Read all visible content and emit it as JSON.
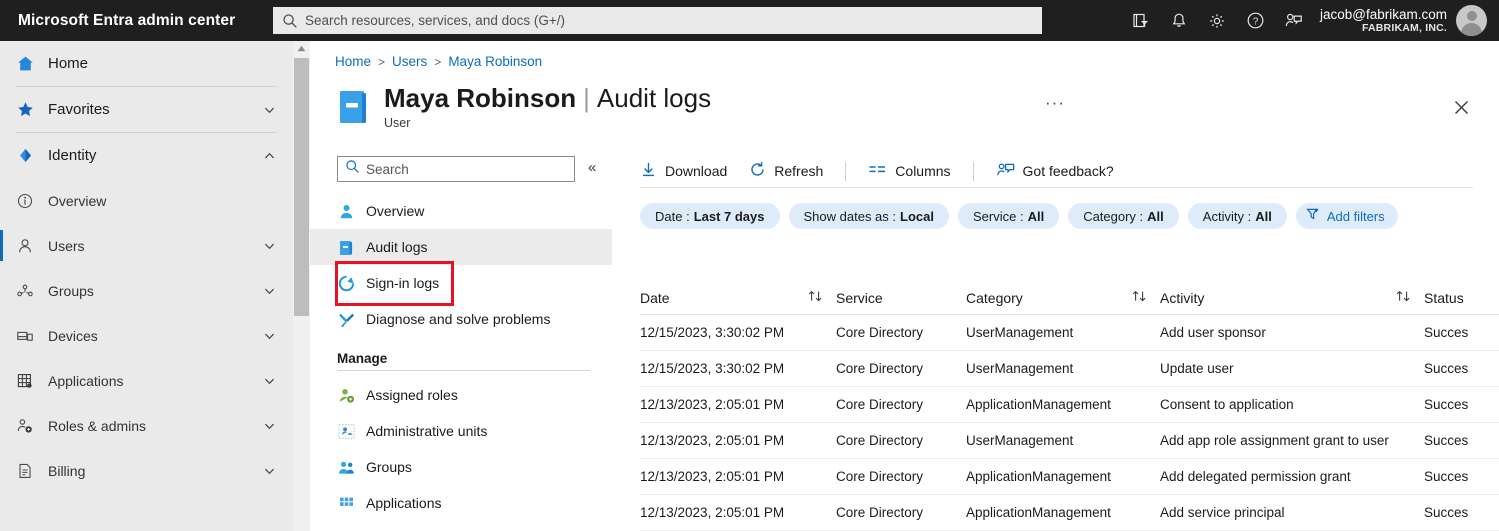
{
  "topbar": {
    "brand": "Microsoft Entra admin center",
    "search_placeholder": "Search resources, services, and docs (G+/)",
    "icons": [
      "directories-filter-icon",
      "notifications-bell-icon",
      "settings-gear-icon",
      "help-question-icon",
      "feedback-person-icon"
    ],
    "account_email": "jacob@fabrikam.com",
    "account_org": "FABRIKAM, INC."
  },
  "sidebar": {
    "items": [
      {
        "label": "Home",
        "icon": "home-icon",
        "chevron": "",
        "selected": false
      },
      {
        "label": "Favorites",
        "icon": "star-icon",
        "chevron": "down",
        "selected": false
      },
      {
        "label": "Identity",
        "icon": "entra-identity-icon",
        "chevron": "up",
        "selected": false
      },
      {
        "label": "Overview",
        "icon": "info-circle-icon",
        "chevron": "",
        "selected": false
      },
      {
        "label": "Users",
        "icon": "user-icon",
        "chevron": "down",
        "selected": true
      },
      {
        "label": "Groups",
        "icon": "groups-icon",
        "chevron": "down",
        "selected": false
      },
      {
        "label": "Devices",
        "icon": "devices-icon",
        "chevron": "down",
        "selected": false
      },
      {
        "label": "Applications",
        "icon": "applications-grid-icon",
        "chevron": "down",
        "selected": false
      },
      {
        "label": "Roles & admins",
        "icon": "roles-admins-icon",
        "chevron": "down",
        "selected": false
      },
      {
        "label": "Billing",
        "icon": "billing-document-icon",
        "chevron": "down",
        "selected": false
      }
    ]
  },
  "breadcrumb": {
    "items": [
      "Home",
      "Users",
      "Maya Robinson"
    ],
    "separator": ">"
  },
  "header": {
    "icon": "blue-book-icon",
    "title_primary": "Maya Robinson",
    "title_divider": "|",
    "title_secondary": "Audit logs",
    "subtitle": "User",
    "more_label": "···",
    "close_label": "✕"
  },
  "blade": {
    "search_placeholder": "Search",
    "collapse_label": "«",
    "menu": [
      {
        "label": "Overview",
        "icon": "user-overview-icon",
        "selected": false
      },
      {
        "label": "Audit logs",
        "icon": "audit-logs-book-icon",
        "selected": true
      },
      {
        "label": "Sign-in logs",
        "icon": "sign-in-logs-icon",
        "selected": false
      },
      {
        "label": "Diagnose and solve problems",
        "icon": "diagnose-wrench-icon",
        "selected": false
      }
    ],
    "section_label": "Manage",
    "manage": [
      {
        "label": "Assigned roles",
        "icon": "assigned-roles-icon",
        "selected": false
      },
      {
        "label": "Administrative units",
        "icon": "administrative-units-icon",
        "selected": false
      },
      {
        "label": "Groups",
        "icon": "groups-people-icon",
        "selected": false
      },
      {
        "label": "Applications",
        "icon": "applications-grid-icon",
        "selected": false
      }
    ]
  },
  "toolbar": {
    "download": "Download",
    "refresh": "Refresh",
    "columns": "Columns",
    "feedback": "Got feedback?"
  },
  "filters": [
    {
      "label": "Date :",
      "value": "Last 7 days"
    },
    {
      "label": "Show dates as :",
      "value": "Local"
    },
    {
      "label": "Service :",
      "value": "All"
    },
    {
      "label": "Category :",
      "value": "All"
    },
    {
      "label": "Activity :",
      "value": "All"
    }
  ],
  "add_filters_label": "Add filters",
  "table": {
    "columns": [
      "Date",
      "Service",
      "Category",
      "Activity",
      "Status"
    ],
    "rows": [
      {
        "date": "12/15/2023, 3:30:02 PM",
        "service": "Core Directory",
        "category": "UserManagement",
        "activity": "Add user sponsor",
        "status": "Succes"
      },
      {
        "date": "12/15/2023, 3:30:02 PM",
        "service": "Core Directory",
        "category": "UserManagement",
        "activity": "Update user",
        "status": "Succes"
      },
      {
        "date": "12/13/2023, 2:05:01 PM",
        "service": "Core Directory",
        "category": "ApplicationManagement",
        "activity": "Consent to application",
        "status": "Succes"
      },
      {
        "date": "12/13/2023, 2:05:01 PM",
        "service": "Core Directory",
        "category": "UserManagement",
        "activity": "Add app role assignment grant to user",
        "status": "Succes"
      },
      {
        "date": "12/13/2023, 2:05:01 PM",
        "service": "Core Directory",
        "category": "ApplicationManagement",
        "activity": "Add delegated permission grant",
        "status": "Succes"
      },
      {
        "date": "12/13/2023, 2:05:01 PM",
        "service": "Core Directory",
        "category": "ApplicationManagement",
        "activity": "Add service principal",
        "status": "Succes"
      }
    ]
  },
  "colors": {
    "topbar_bg": "#1f1f1f",
    "sidebar_bg": "#eaeaea",
    "link_blue": "#0f6cbd",
    "pill_bg": "#deecf9",
    "annotation_red": "#e81123"
  }
}
